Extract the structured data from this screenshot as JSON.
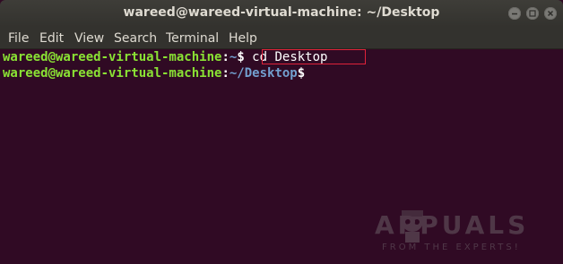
{
  "window": {
    "title": "wareed@wareed-virtual-machine: ~/Desktop"
  },
  "menu": {
    "items": [
      "File",
      "Edit",
      "View",
      "Search",
      "Terminal",
      "Help"
    ]
  },
  "terminal": {
    "lines": [
      {
        "user_host": "wareed@wareed-virtual-machine",
        "colon": ":",
        "path": "~",
        "prompt": "$",
        "command": " cd Desktop"
      },
      {
        "user_host": "wareed@wareed-virtual-machine",
        "colon": ":",
        "path": "~/Desktop",
        "prompt": "$",
        "command": ""
      }
    ],
    "highlight_color": "#e0223a"
  },
  "watermark": {
    "brand": "APPUALS",
    "tagline": "FROM THE EXPERTS!"
  },
  "icons": {
    "minimize": "minimize-icon",
    "maximize": "maximize-icon",
    "close": "close-icon"
  }
}
